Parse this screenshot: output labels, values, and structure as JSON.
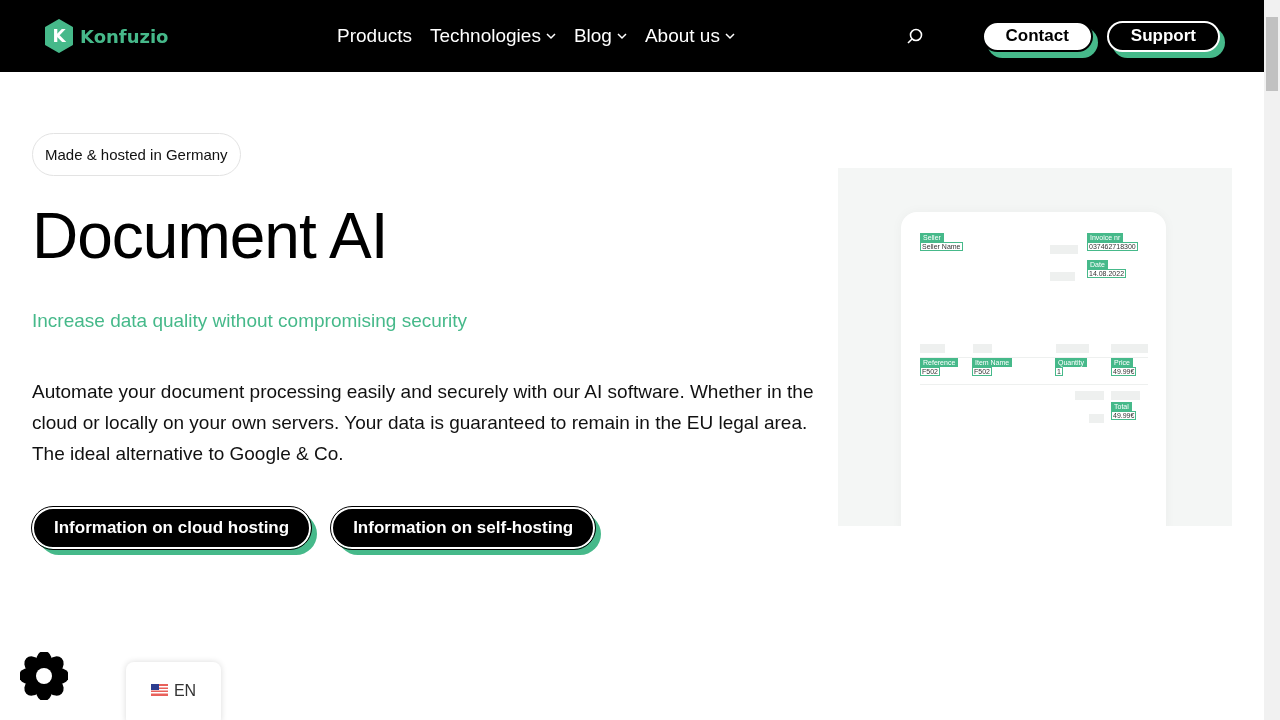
{
  "header": {
    "logo_letter": "K",
    "brand": "Konfuzio",
    "nav": [
      {
        "label": "Products",
        "dropdown": false
      },
      {
        "label": "Technologies",
        "dropdown": true
      },
      {
        "label": "Blog",
        "dropdown": true
      },
      {
        "label": "About us",
        "dropdown": true
      }
    ],
    "buttons": [
      {
        "label": "Contact",
        "kind": "filled"
      },
      {
        "label": "Support",
        "kind": "outline"
      }
    ]
  },
  "hero": {
    "badge": "Made & hosted in Germany",
    "title": "Document AI",
    "subtitle": "Increase data quality without compromising security",
    "body": "Automate your document processing easily and securely with our AI software. Whether in the cloud or locally on your own servers. Your data is guaranteed to remain in the EU legal area. The ideal alternative to Google & Co.",
    "buttons": [
      "Information on cloud hosting",
      "Information on self-hosting"
    ]
  },
  "invoice": {
    "fields": [
      {
        "label": "Seller",
        "value": "Seller Name"
      },
      {
        "label": "Invoice nr",
        "value": "037462718300"
      },
      {
        "label": "Date",
        "value": "14.08.2022"
      },
      {
        "label": "Reference",
        "value": "F502"
      },
      {
        "label": "Item Name",
        "value": "F502"
      },
      {
        "label": "Quantity",
        "value": "1"
      },
      {
        "label": "Price",
        "value": "49.99€"
      },
      {
        "label": "Total",
        "value": "49.99€"
      }
    ]
  },
  "language": {
    "code": "EN"
  }
}
